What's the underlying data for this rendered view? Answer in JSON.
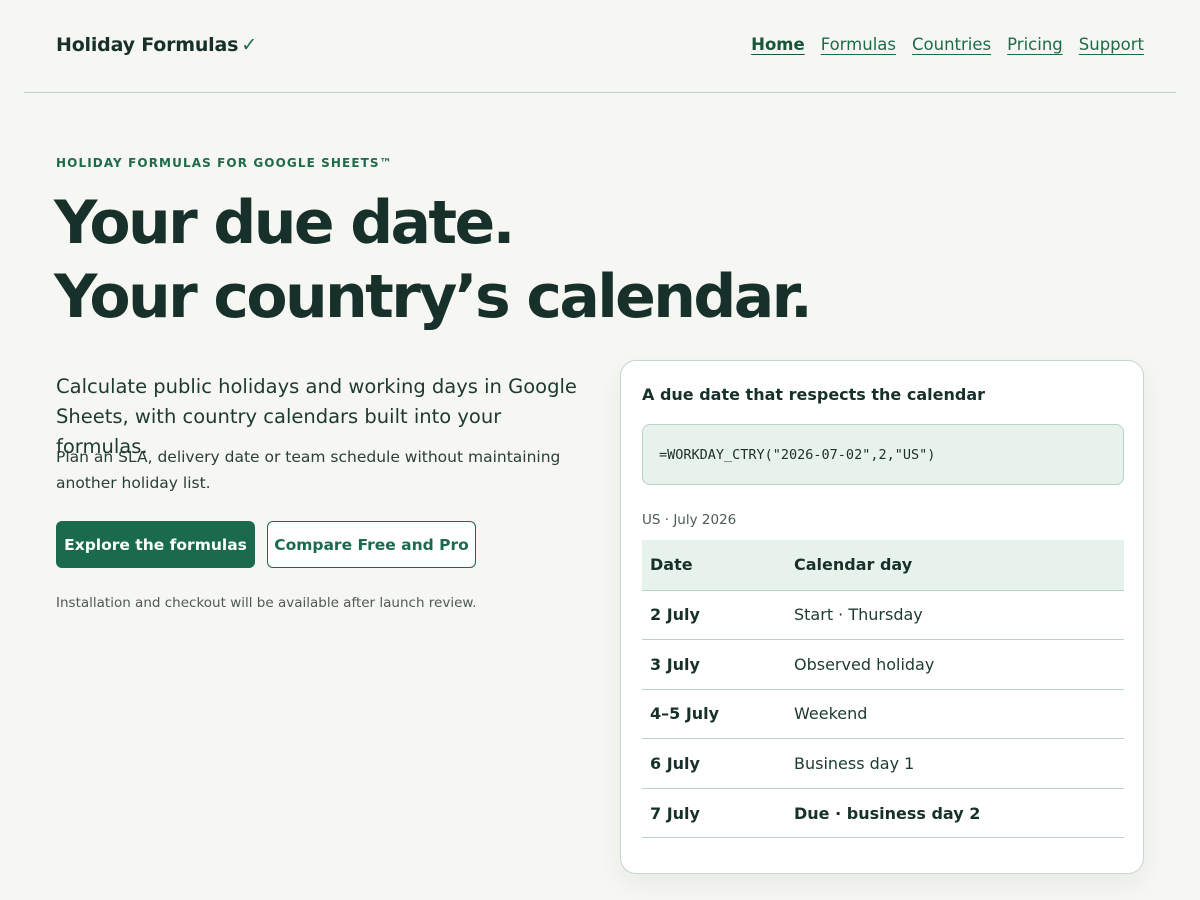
{
  "brand": {
    "name": "Holiday Formulas",
    "mark": "✓"
  },
  "nav": {
    "items": [
      {
        "label": "Home",
        "active": true
      },
      {
        "label": "Formulas",
        "active": false
      },
      {
        "label": "Countries",
        "active": false
      },
      {
        "label": "Pricing",
        "active": false
      },
      {
        "label": "Support",
        "active": false
      }
    ]
  },
  "hero": {
    "eyebrow": "HOLIDAY FORMULAS FOR GOOGLE SHEETS™",
    "headline_line1": "Your due date.",
    "headline_line2": "Your country’s calendar.",
    "lead": "Calculate public holidays and working days in Google Sheets, with country calendars built into your formulas.",
    "sub": "Plan an SLA, delivery date or team schedule without maintaining another holiday list.",
    "primary_button": "Explore the formulas",
    "secondary_button": "Compare Free and Pro",
    "note": "Installation and checkout will be available after launch review."
  },
  "card": {
    "title": "A due date that respects the calendar",
    "formula": "=WORKDAY_CTRY(\"2026-07-02\",2,\"US\")",
    "meta": "US · July 2026",
    "columns": [
      "Date",
      "Calendar day"
    ],
    "rows": [
      {
        "date": "2 July",
        "day": "Start · Thursday"
      },
      {
        "date": "3 July",
        "day": "Observed holiday"
      },
      {
        "date": "4–5 July",
        "day": "Weekend"
      },
      {
        "date": "6 July",
        "day": "Business day 1"
      },
      {
        "date": "7 July",
        "day": "Due · business day 2"
      }
    ]
  },
  "colors": {
    "accent": "#1a6b4b",
    "text": "#17312a",
    "background": "#f6f6f3",
    "tint": "#e8f2ec"
  }
}
